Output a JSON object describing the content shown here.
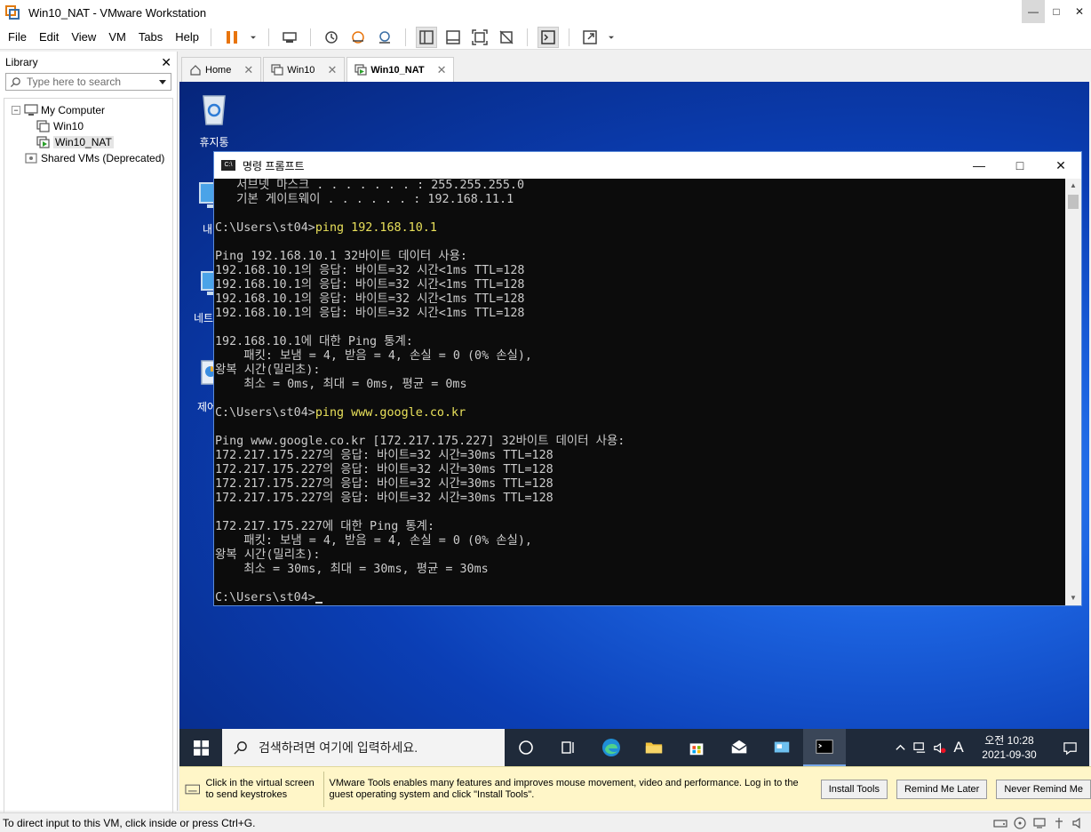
{
  "window": {
    "title": "Win10_NAT - VMware Workstation"
  },
  "menu": [
    {
      "label": "File",
      "name": "menu-file"
    },
    {
      "label": "Edit",
      "name": "menu-edit"
    },
    {
      "label": "View",
      "name": "menu-view"
    },
    {
      "label": "VM",
      "name": "menu-vm"
    },
    {
      "label": "Tabs",
      "name": "menu-tabs"
    },
    {
      "label": "Help",
      "name": "menu-help"
    }
  ],
  "library": {
    "title": "Library",
    "search_placeholder": "Type here to search",
    "tree": [
      {
        "label": "My Computer",
        "level": 0
      },
      {
        "label": "Win10",
        "level": 1
      },
      {
        "label": "Win10_NAT",
        "level": 1
      },
      {
        "label": "Shared VMs (Deprecated)",
        "level": 0
      }
    ]
  },
  "tabs": [
    {
      "label": "Home"
    },
    {
      "label": "Win10"
    },
    {
      "label": "Win10_NAT"
    }
  ],
  "desktop": {
    "icons": [
      {
        "label": "휴지통"
      },
      {
        "label": "내"
      },
      {
        "label": "네트"
      },
      {
        "label": "제어"
      }
    ]
  },
  "cmd": {
    "title": "명령 프롬프트",
    "lines": [
      "   서브넷 마스크 . . . . . . . : 255.255.255.0",
      "   기본 게이트웨이 . . . . . . : 192.168.11.1",
      "",
      "C:\\Users\\st04>",
      "",
      "Ping 192.168.10.1 32바이트 데이터 사용:",
      "192.168.10.1의 응답: 바이트=32 시간<1ms TTL=128",
      "192.168.10.1의 응답: 바이트=32 시간<1ms TTL=128",
      "192.168.10.1의 응답: 바이트=32 시간<1ms TTL=128",
      "192.168.10.1의 응답: 바이트=32 시간<1ms TTL=128",
      "",
      "192.168.10.1에 대한 Ping 통계:",
      "    패킷: 보냄 = 4, 받음 = 4, 손실 = 0 (0% 손실),",
      "왕복 시간(밀리초):",
      "    최소 = 0ms, 최대 = 0ms, 평균 = 0ms",
      "",
      "C:\\Users\\st04>",
      "",
      "Ping www.google.co.kr [172.217.175.227] 32바이트 데이터 사용:",
      "172.217.175.227의 응답: 바이트=32 시간=30ms TTL=128",
      "172.217.175.227의 응답: 바이트=32 시간=30ms TTL=128",
      "172.217.175.227의 응답: 바이트=32 시간=30ms TTL=128",
      "172.217.175.227의 응답: 바이트=32 시간=30ms TTL=128",
      "",
      "172.217.175.227에 대한 Ping 통계:",
      "    패킷: 보냄 = 4, 받음 = 4, 손실 = 0 (0% 손실),",
      "왕복 시간(밀리초):",
      "    최소 = 30ms, 최대 = 30ms, 평균 = 30ms",
      "",
      "C:\\Users\\st04>"
    ],
    "command_1": "ping 192.168.10.1",
    "command_2": "ping www.google.co.kr"
  },
  "taskbar": {
    "search_placeholder": "검색하려면 여기에 입력하세요.",
    "ime": "A",
    "time": "오전 10:28",
    "date": "2021-09-30"
  },
  "tools_bar": {
    "hint": "Click in the virtual screen to send keystrokes",
    "message": "VMware Tools enables many features and improves mouse movement, video and performance. Log in to the guest operating system and click \"Install Tools\".",
    "install_label": "Install Tools",
    "remind_label": "Remind Me Later",
    "never_label": "Never Remind Me"
  },
  "status": {
    "text": "To direct input to this VM, click inside or press Ctrl+G."
  }
}
